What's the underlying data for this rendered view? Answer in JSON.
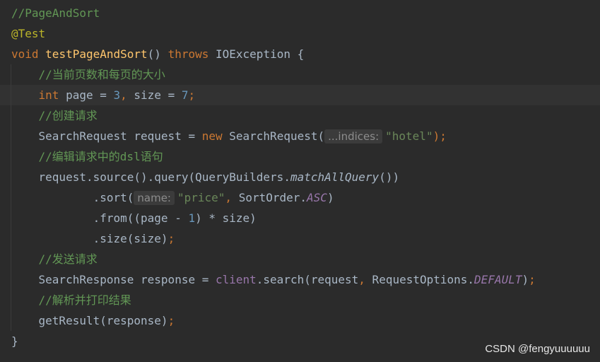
{
  "editor": {
    "l1": "//PageAndSort",
    "l2": "@Test",
    "l3_kw": "void",
    "l3_name": "testPageAndSort",
    "l3_paren": "() ",
    "l3_throws": "throws",
    "l3_rest": " IOException {",
    "l4": "//当前页数和每页的大小",
    "l5_kw": "int",
    "l5_a": " page = ",
    "l5_n1": "3",
    "l5_c": ",",
    "l5_b": " size = ",
    "l5_n2": "7",
    "l5_s": ";",
    "l6": "//创建请求",
    "l7_a": "SearchRequest request = ",
    "l7_new": "new",
    "l7_b": " SearchRequest(",
    "l7_hint": "...indices:",
    "l7_str": "\"hotel\"",
    "l7_end": ");",
    "l8": "//编辑请求中的dsl语句",
    "l9_a": "request.source().query(QueryBuilders.",
    "l9_m": "matchAllQuery",
    "l9_b": "())",
    "l10_a": ".sort(",
    "l10_hint": "name:",
    "l10_str": "\"price\"",
    "l10_c": ",",
    "l10_b": " SortOrder.",
    "l10_f": "ASC",
    "l10_end": ")",
    "l11_a": ".from((page - ",
    "l11_n": "1",
    "l11_b": ") * size)",
    "l12_a": ".size(size)",
    "l12_s": ";",
    "l13": "//发送请求",
    "l14_a": "SearchResponse response = ",
    "l14_client": "client",
    "l14_b": ".search(request",
    "l14_c": ",",
    "l14_d": " RequestOptions.",
    "l14_f": "DEFAULT",
    "l14_end": ")",
    "l14_s": ";",
    "l15": "//解析并打印结果",
    "l16_a": "getResult(response)",
    "l16_s": ";",
    "l17": "}"
  },
  "watermark": "CSDN @fengyuuuuuu",
  "colors": {
    "background": "#2b2b2b",
    "comment": "#629755",
    "keyword": "#cc7832",
    "method_declaration": "#ffc66d",
    "number": "#6897bb",
    "string": "#6a8759",
    "field": "#9876aa",
    "annotation": "#bbb529"
  }
}
